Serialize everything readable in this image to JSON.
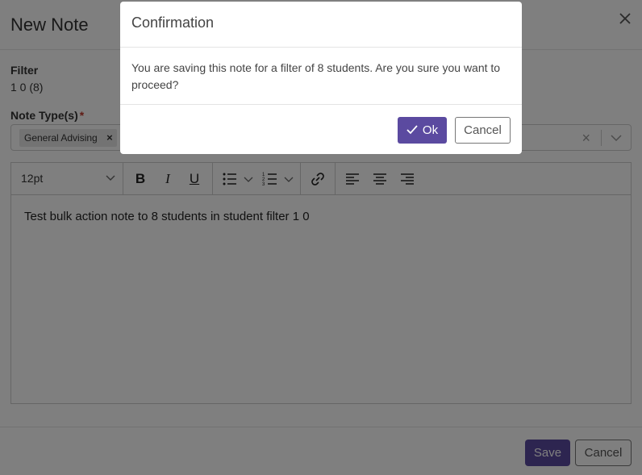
{
  "note_modal": {
    "title": "New Note",
    "close_icon": "close-icon",
    "filter": {
      "label": "Filter",
      "value": "1 0 (8)"
    },
    "note_types": {
      "label": "Note Type(s)",
      "required_marker": "*",
      "selected": [
        "General Advising"
      ]
    },
    "editor": {
      "font_size": "12pt",
      "toolbar_icons": [
        "bold-icon",
        "italic-icon",
        "underline-icon",
        "bullet-list-icon",
        "numbered-list-icon",
        "link-icon",
        "align-left-icon",
        "align-center-icon",
        "align-right-icon"
      ],
      "toolbar_glyphs": {
        "bold": "B",
        "italic": "I",
        "underline": "U"
      },
      "content": "Test bulk action note to 8 students in student filter 1 0"
    },
    "footer": {
      "save_label": "Save",
      "cancel_label": "Cancel"
    }
  },
  "confirmation": {
    "title": "Confirmation",
    "message": "You are saving this note for a filter of 8 students. Are you sure you want to proceed?",
    "ok_label": "Ok",
    "cancel_label": "Cancel"
  },
  "colors": {
    "primary": "#5b4aa0",
    "overlay": "rgba(0,0,0,0.5)"
  }
}
